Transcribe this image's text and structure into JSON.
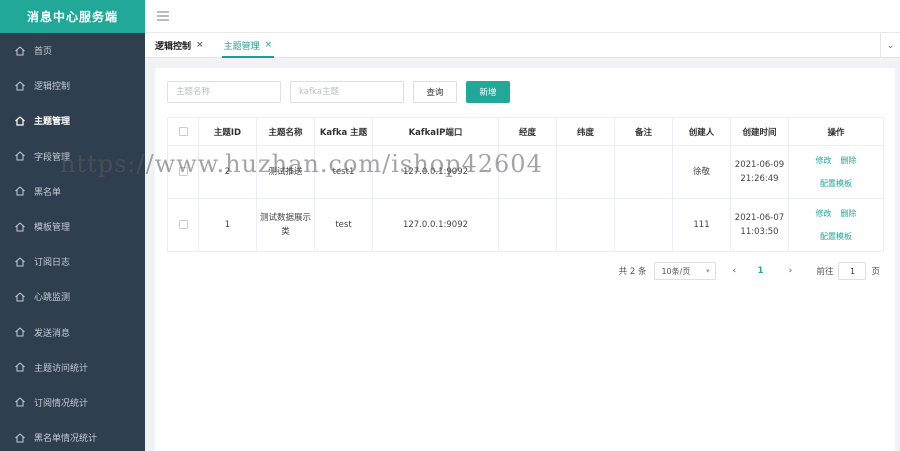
{
  "sidebar": {
    "logo": "消息中心服务端",
    "items": [
      {
        "label": "首页",
        "active": false
      },
      {
        "label": "逻辑控制",
        "active": false
      },
      {
        "label": "主题管理",
        "active": true
      },
      {
        "label": "字段管理",
        "active": false
      },
      {
        "label": "黑名单",
        "active": false
      },
      {
        "label": "模板管理",
        "active": false
      },
      {
        "label": "订阅日志",
        "active": false
      },
      {
        "label": "心跳监测",
        "active": false
      },
      {
        "label": "发送消息",
        "active": false
      },
      {
        "label": "主题访问统计",
        "active": false
      },
      {
        "label": "订阅情况统计",
        "active": false
      },
      {
        "label": "黑名单情况统计",
        "active": false
      }
    ]
  },
  "tabs": [
    {
      "label": "逻辑控制",
      "close": "×"
    },
    {
      "label": "主题管理",
      "close": "×"
    }
  ],
  "tabs_dropdown": "⌄",
  "search": {
    "name_placeholder": "主题名称",
    "kafka_placeholder": "kafka主题",
    "query_label": "查询",
    "add_label": "新增"
  },
  "table": {
    "headers": [
      "主题ID",
      "主题名称",
      "Kafka 主题",
      "KafkaIP端口",
      "经度",
      "纬度",
      "备注",
      "创建人",
      "创建时间",
      "操作"
    ],
    "rows": [
      {
        "id": "2",
        "name": "测试推送",
        "kafka_topic": "test1",
        "kafka_ip": "127.0.0.1:9092",
        "lng": "",
        "lat": "",
        "remark": "",
        "creator": "徐敬",
        "created": "2021-06-09 21:26:49"
      },
      {
        "id": "1",
        "name": "测试数据展示类",
        "kafka_topic": "test",
        "kafka_ip": "127.0.0.1:9092",
        "lng": "",
        "lat": "",
        "remark": "",
        "creator": "111",
        "created": "2021-06-07 11:03:50"
      }
    ],
    "ops": {
      "edit": "修改",
      "delete": "删除",
      "config": "配置模板"
    }
  },
  "pager": {
    "total": "共 2 条",
    "page_size": "10条/页",
    "prev": "‹",
    "current": "1",
    "next": "›",
    "goto_label": "前往",
    "goto_value": "1",
    "page_unit": "页"
  },
  "watermark": "https://www.huzhan.com/ishop42604",
  "colors": {
    "accent": "#22a899",
    "sidebar": "#2f3f4f"
  }
}
